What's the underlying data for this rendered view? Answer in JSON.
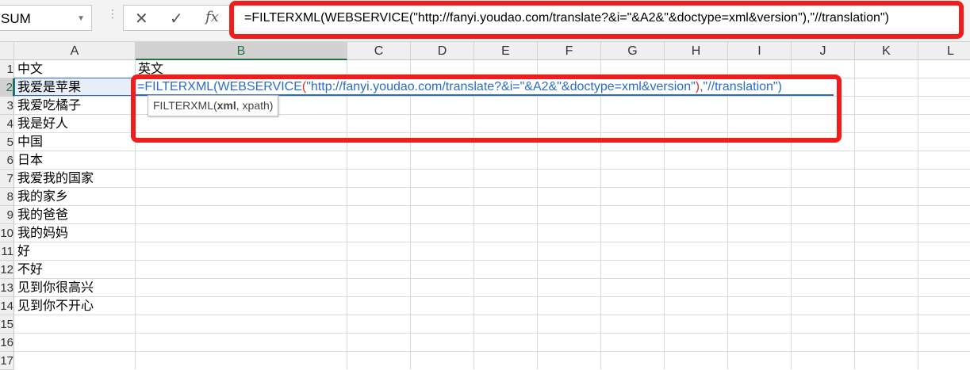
{
  "name_box": "SUM",
  "formula_bar": {
    "cancel_icon": "✕",
    "enter_icon": "✓",
    "fx_label": "fx",
    "value": "=FILTERXML(WEBSERVICE(\"http://fanyi.youdao.com/translate?&i=\"&A2&\"&doctype=xml&version\"),\"//translation\")"
  },
  "columns": [
    "A",
    "B",
    "C",
    "D",
    "E",
    "F",
    "G",
    "H",
    "I",
    "J",
    "K",
    "L"
  ],
  "rows": [
    "1",
    "2",
    "3",
    "4",
    "5",
    "6",
    "7",
    "8",
    "9",
    "10",
    "11",
    "12",
    "13",
    "14",
    "15",
    "16",
    "17"
  ],
  "cells_a": [
    "中文",
    "我爱是苹果",
    "我爱吃橘子",
    "我是好人",
    "中国",
    "日本",
    "我爱我的国家",
    "我的家乡",
    "我的爸爸",
    "我的妈妈",
    "好",
    "不好",
    "见到你很高兴",
    "见到你不开心"
  ],
  "b1": "英文",
  "edit": {
    "p1": "=FILTERXML(WEBSERVICE",
    "p2": "(",
    "p3": "\"http://fanyi.youdao.com/translate?&i=\"&A2&\"&doctype=xml&version\"",
    "p4": ")",
    "p5": ",\"//translation\")"
  },
  "tooltip": {
    "fn": "FILTERXML(",
    "arg1": "xml",
    ",rest": ", xpath)",
    "rest": ", xpath)"
  }
}
